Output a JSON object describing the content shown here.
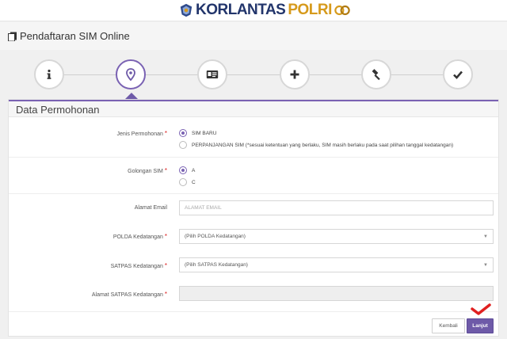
{
  "brand": {
    "part1": "KORLANTAS",
    "part2": "POLRI"
  },
  "header": {
    "title": "Pendaftaran SIM Online"
  },
  "stepper": {
    "steps": [
      {
        "icon": "info-icon",
        "active": false
      },
      {
        "icon": "map-marker-icon",
        "active": true
      },
      {
        "icon": "id-card-icon",
        "active": false
      },
      {
        "icon": "plus-icon",
        "active": false
      },
      {
        "icon": "gavel-icon",
        "active": false
      },
      {
        "icon": "check-icon",
        "active": false
      }
    ]
  },
  "form": {
    "title": "Data Permohonan",
    "jenis": {
      "label": "Jenis Permohonan",
      "options": [
        "SIM BARU",
        "PERPANJANGAN SIM (*sesuai ketentuan yang berlaku, SIM masih berlaku pada saat pilihan tanggal kedatangan)"
      ],
      "selected": "SIM BARU"
    },
    "golongan": {
      "label": "Golongan SIM",
      "options": [
        "A",
        "C"
      ],
      "selected": "A"
    },
    "email": {
      "label": "Alamat Email",
      "placeholder": "ALAMAT EMAIL"
    },
    "polda": {
      "label": "POLDA Kedatangan",
      "value": "(Pilih POLDA Kedatangan)"
    },
    "satpas": {
      "label": "SATPAS Kedatangan",
      "value": "(Pilih SATPAS Kedatangan)"
    },
    "alamat_satpas": {
      "label": "Alamat SATPAS Kedatangan",
      "value": ""
    },
    "required_mark": "*"
  },
  "buttons": {
    "back": "Kembali",
    "next": "Lanjut"
  },
  "colors": {
    "accent": "#6e5aa8",
    "required": "#dd2222",
    "annotation": "#e02020"
  }
}
